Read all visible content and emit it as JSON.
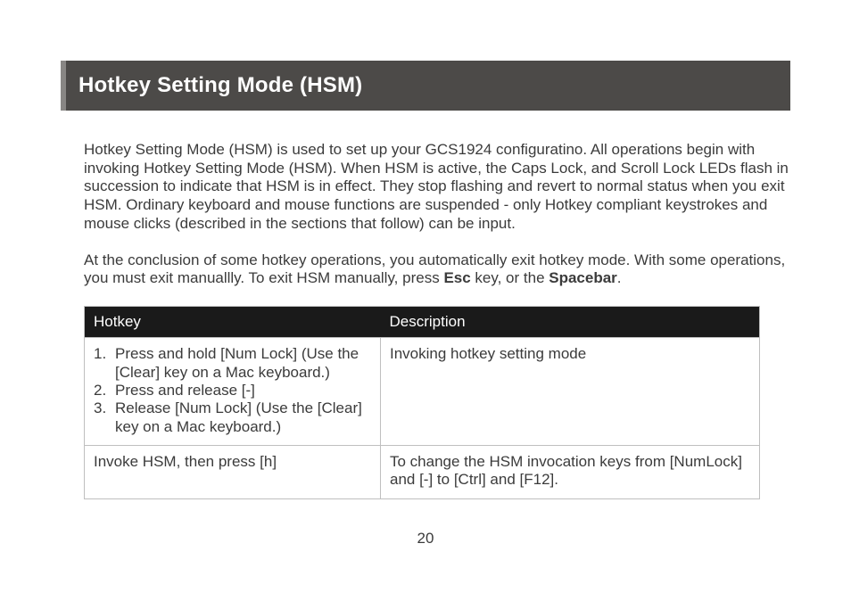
{
  "title": "Hotkey Setting Mode (HSM)",
  "para1": "Hotkey Setting Mode (HSM) is used to set up your GCS1924 configuratino.  All operations begin with invoking Hotkey Setting Mode (HSM).  When HSM is active, the Caps Lock, and Scroll Lock LEDs flash in succession to indicate that HSM is in effect. They stop flashing and revert to normal status when you exit HSM.   Ordinary keyboard and mouse functions are suspended - only Hotkey compliant keystrokes and mouse clicks (described in the sections that follow) can be input.",
  "para2_a": "At the conclusion of some hotkey operations, you automatically exit hotkey mode.  With some operations, you must exit manuallly.  To exit HSM manually, press ",
  "para2_b1": "Esc",
  "para2_c": " key, or the ",
  "para2_b2": "Spacebar",
  "para2_d": ".",
  "table": {
    "head": {
      "c1": "Hotkey",
      "c2": "Description"
    },
    "rows": [
      {
        "hotkey_steps": [
          {
            "n": "1.",
            "t": "Press and hold [Num Lock] (Use the [Clear] key on a Mac keyboard.)"
          },
          {
            "n": "2.",
            "t": "Press and release [-]"
          },
          {
            "n": "3.",
            "t": "Release [Num Lock] (Use the [Clear] key on a Mac keyboard.)"
          }
        ],
        "desc": "Invoking hotkey setting mode"
      },
      {
        "hotkey_text": "Invoke HSM, then press [h]",
        "desc": "To change the HSM invocation keys from [NumLock] and [-] to [Ctrl] and [F12]."
      }
    ]
  },
  "page_number": "20"
}
